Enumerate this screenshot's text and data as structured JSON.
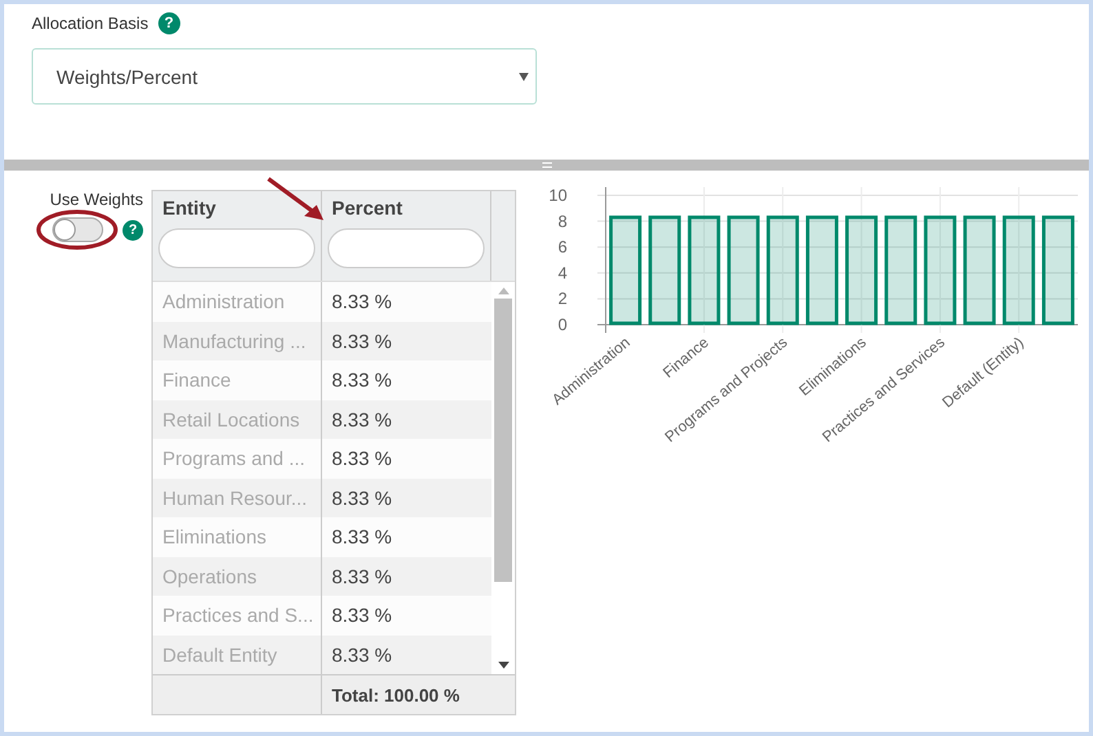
{
  "allocation_basis": {
    "label": "Allocation Basis",
    "help_icon": "?",
    "value": "Weights/Percent"
  },
  "use_weights": {
    "label": "Use Weights",
    "on": false,
    "help_icon": "?"
  },
  "table": {
    "columns": [
      "Entity",
      "Percent"
    ],
    "rows": [
      {
        "entity": "Administration",
        "percent": "8.33 %"
      },
      {
        "entity": "Manufacturing ...",
        "percent": "8.33 %"
      },
      {
        "entity": "Finance",
        "percent": "8.33 %"
      },
      {
        "entity": "Retail Locations",
        "percent": "8.33 %"
      },
      {
        "entity": "Programs and ...",
        "percent": "8.33 %"
      },
      {
        "entity": "Human Resour...",
        "percent": "8.33 %"
      },
      {
        "entity": "Eliminations",
        "percent": "8.33 %"
      },
      {
        "entity": "Operations",
        "percent": "8.33 %"
      },
      {
        "entity": "Practices and S...",
        "percent": "8.33 %"
      },
      {
        "entity": "Default Entity",
        "percent": "8.33 %"
      }
    ],
    "total": "Total: 100.00 %"
  },
  "chart_data": {
    "type": "bar",
    "categories": [
      "Administration",
      null,
      "Finance",
      null,
      "Programs and Projects",
      null,
      "Eliminations",
      null,
      "Practices and Services",
      null,
      "Default (Entity)",
      null
    ],
    "series": [
      {
        "color": "#00896b",
        "values": [
          8.3,
          8.3,
          8.3,
          8.3,
          8.3,
          8.3,
          8.3,
          8.3,
          8.3,
          8.3,
          8.3,
          8.3
        ]
      }
    ],
    "ylim": [
      0,
      10
    ],
    "yticks": [
      0,
      2,
      4,
      6,
      8,
      10
    ],
    "grid": true
  }
}
